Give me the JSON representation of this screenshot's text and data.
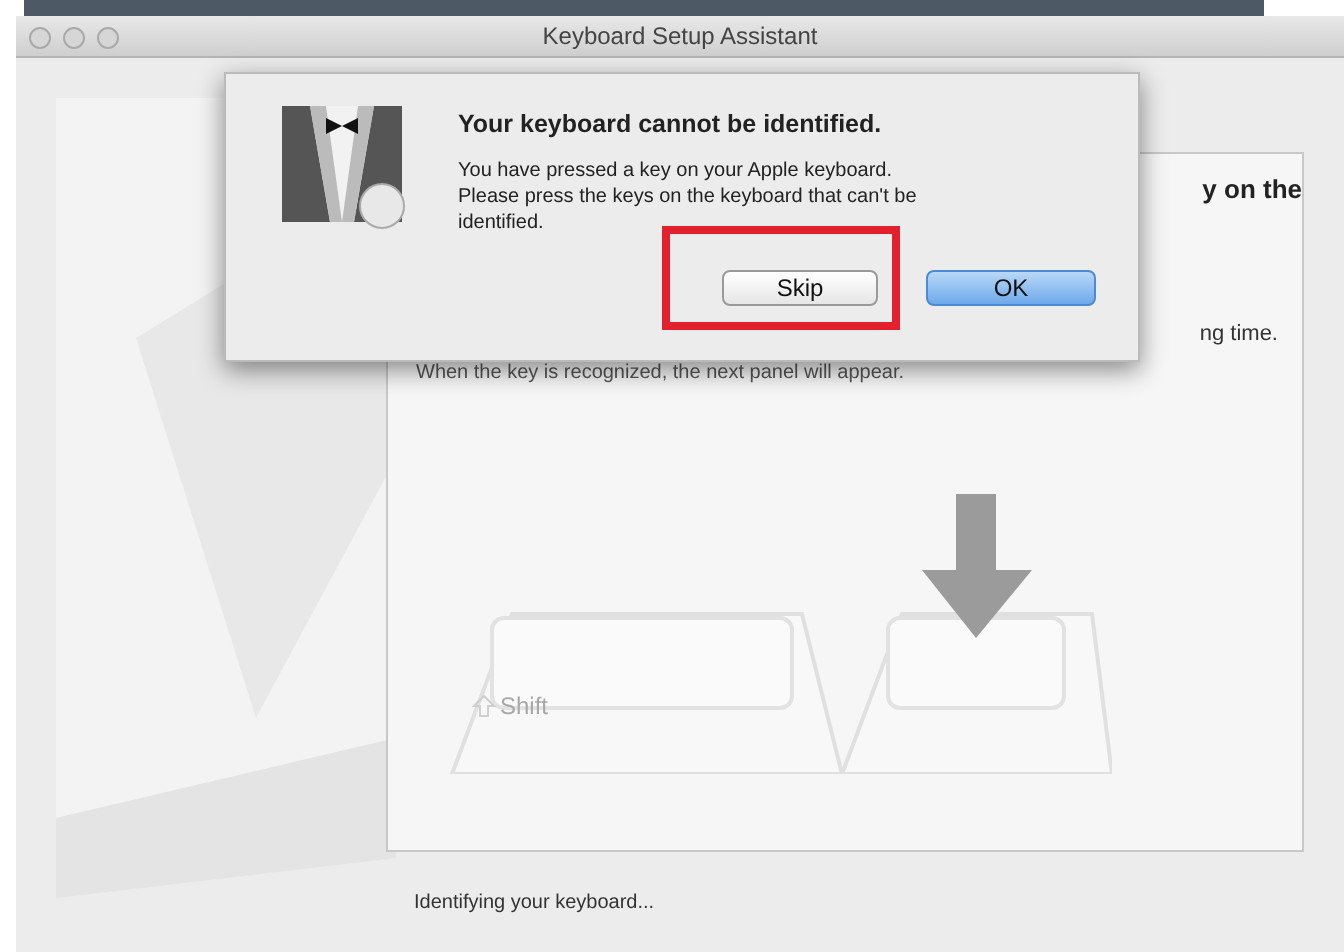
{
  "window": {
    "title": "Keyboard Setup Assistant"
  },
  "panel": {
    "heading_fragment": "y on the",
    "text_fragment": "ng time.",
    "note": "When the key is recognized, the next panel will appear.",
    "key_label": "Shift"
  },
  "dialog": {
    "title": "Your keyboard cannot be identified.",
    "message": "You have pressed a key on your Apple keyboard. Please press the keys on the keyboard that can't be identified.",
    "buttons": [
      {
        "label": "Skip",
        "default": false,
        "highlighted": true
      },
      {
        "label": "OK",
        "default": true,
        "highlighted": false
      }
    ]
  },
  "status": "Identifying your keyboard..."
}
